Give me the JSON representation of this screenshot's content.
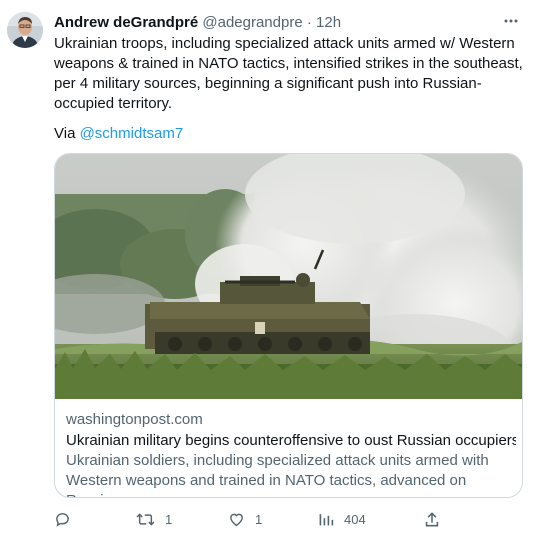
{
  "author": {
    "display_name": "Andrew deGrandpré",
    "handle": "@adegrandpre",
    "separator": "·",
    "time": "12h"
  },
  "tweet": {
    "text": "Ukrainian troops, including specialized attack units armed w/ Western weapons & trained in NATO tactics, intensified strikes in the southeast, per 4 military sources, beginning a significant push into Russian-occupied territory.",
    "via_prefix": "Via ",
    "via_mention": "@schmidtsam7"
  },
  "card": {
    "domain": "washingtonpost.com",
    "title": "Ukrainian military begins counteroffensive to oust Russian occupiers",
    "description": "Ukrainian soldiers, including specialized attack units armed with Western weapons and trained in NATO tactics, advanced on Russian ..."
  },
  "actions": {
    "reply_icon": "reply-icon",
    "retweet_icon": "retweet-icon",
    "retweet_count": "1",
    "like_icon": "heart-icon",
    "like_count": "1",
    "views_icon": "views-icon",
    "views_count": "404",
    "share_icon": "share-icon"
  },
  "colors": {
    "link": "#1d9bf0",
    "secondary_text": "#536471",
    "primary_text": "#0f1419",
    "border": "#cfd9de"
  }
}
